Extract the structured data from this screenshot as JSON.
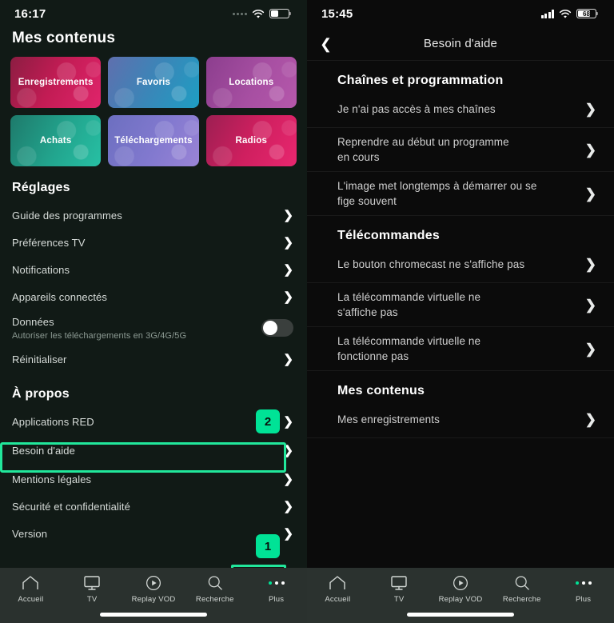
{
  "left": {
    "status": {
      "time": "16:17",
      "signal_icon": "signal-dots-icon",
      "wifi_icon": "wifi-icon",
      "battery_icon": "battery-icon"
    },
    "page_title": "Mes contenus",
    "tiles": [
      {
        "label": "Enregistrements",
        "color": "#c21c54"
      },
      {
        "label": "Favoris",
        "color": "#3a86b8"
      },
      {
        "label": "Locations",
        "color": "#a74fa2"
      },
      {
        "label": "Achats",
        "color": "#22a58e"
      },
      {
        "label": "Téléchargements",
        "color": "#8279cf"
      },
      {
        "label": "Radios",
        "color": "#cf1f5f"
      }
    ],
    "settings_header": "Réglages",
    "settings": [
      {
        "label": "Guide des programmes",
        "control": "chevron"
      },
      {
        "label": "Préférences TV",
        "control": "chevron"
      },
      {
        "label": "Notifications",
        "control": "chevron"
      },
      {
        "label": "Appareils connectés",
        "control": "chevron"
      },
      {
        "label": "Données",
        "sub": "Autoriser les téléchargements en 3G/4G/5G",
        "control": "toggle",
        "toggle_on": false
      },
      {
        "label": "Réinitialiser",
        "control": "chevron"
      }
    ],
    "about_header": "À propos",
    "about": [
      {
        "label": "Applications RED",
        "control": "chevron"
      },
      {
        "label": "Besoin d'aide",
        "control": "chevron",
        "highlighted": true
      },
      {
        "label": "Mentions légales",
        "control": "chevron"
      },
      {
        "label": "Sécurité et confidentialité",
        "control": "chevron"
      },
      {
        "label": "Version",
        "control": "chevron"
      }
    ],
    "annotations": {
      "step_two": "2",
      "step_one": "1",
      "accent_color": "#00e396",
      "outline_color": "#21e79b"
    },
    "tabs": [
      {
        "label": "Accueil",
        "icon": "home-icon",
        "active": false
      },
      {
        "label": "TV",
        "icon": "tv-icon",
        "active": false
      },
      {
        "label": "Replay VOD",
        "icon": "play-circle-icon",
        "active": false
      },
      {
        "label": "Recherche",
        "icon": "search-icon",
        "active": false
      },
      {
        "label": "Plus",
        "icon": "more-dots-icon",
        "active": true
      }
    ]
  },
  "right": {
    "status": {
      "time": "15:45",
      "signal_icon": "cell-bars-icon",
      "wifi_icon": "wifi-icon",
      "battery_level": "68"
    },
    "nav": {
      "back_icon": "chevron-left-icon",
      "title": "Besoin d'aide"
    },
    "sections": [
      {
        "header": "Chaînes et programmation",
        "items": [
          "Je n'ai pas accès à mes chaînes",
          "Reprendre au début un programme en cours",
          "L'image met longtemps à démarrer ou se fige souvent"
        ]
      },
      {
        "header": "Télécommandes",
        "items": [
          "Le bouton chromecast ne s'affiche pas",
          "La télécommande virtuelle ne s'affiche pas",
          "La télécommande virtuelle ne fonctionne pas"
        ]
      },
      {
        "header": "Mes contenus",
        "items": [
          "Mes enregistrements"
        ]
      }
    ],
    "tabs": [
      {
        "label": "Accueil",
        "icon": "home-icon"
      },
      {
        "label": "TV",
        "icon": "tv-icon"
      },
      {
        "label": "Replay VOD",
        "icon": "play-circle-icon"
      },
      {
        "label": "Recherche",
        "icon": "search-icon"
      },
      {
        "label": "Plus",
        "icon": "more-dots-icon"
      }
    ]
  }
}
